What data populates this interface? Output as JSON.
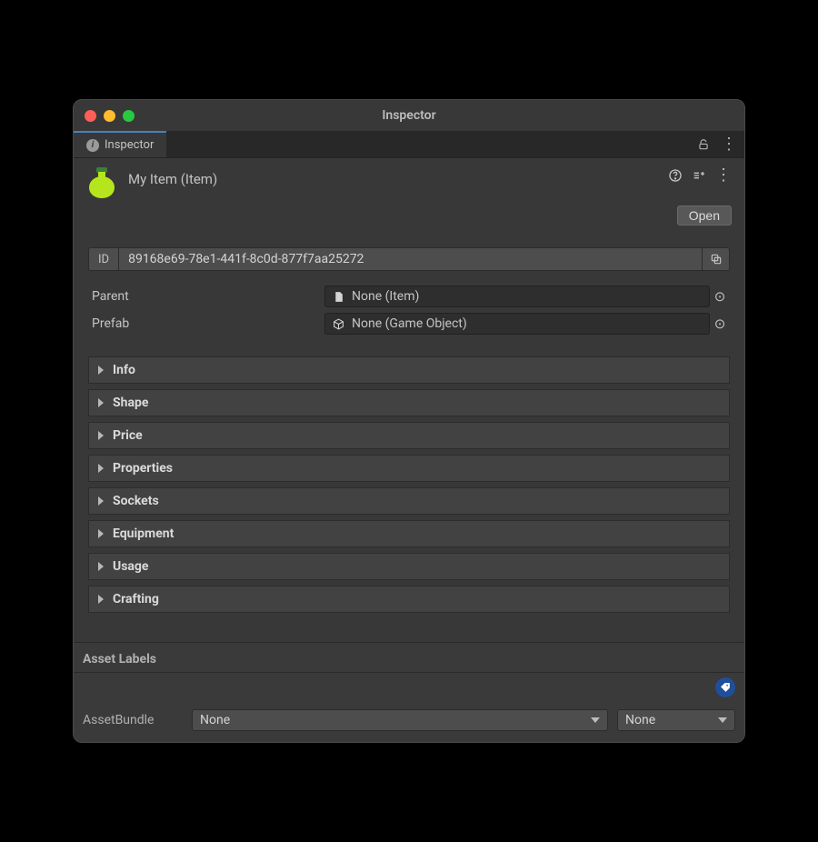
{
  "window": {
    "title": "Inspector"
  },
  "tab": {
    "label": "Inspector"
  },
  "header": {
    "title": "My Item (Item)",
    "open_label": "Open"
  },
  "fields": {
    "id_label": "ID",
    "id_value": "89168e69-78e1-441f-8c0d-877f7aa25272",
    "parent_label": "Parent",
    "parent_value": "None (Item)",
    "prefab_label": "Prefab",
    "prefab_value": "None (Game Object)"
  },
  "foldouts": [
    "Info",
    "Shape",
    "Price",
    "Properties",
    "Sockets",
    "Equipment",
    "Usage",
    "Crafting"
  ],
  "footer": {
    "asset_labels_title": "Asset Labels",
    "assetbundle_label": "AssetBundle",
    "bundle_value": "None",
    "variant_value": "None"
  }
}
